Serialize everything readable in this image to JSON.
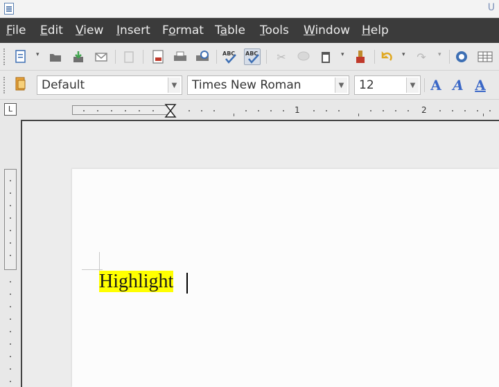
{
  "titlebar": {
    "title_fragment": "U"
  },
  "menu": {
    "items": [
      {
        "pre": "",
        "u": "F",
        "post": "ile"
      },
      {
        "pre": "",
        "u": "E",
        "post": "dit"
      },
      {
        "pre": "",
        "u": "V",
        "post": "iew"
      },
      {
        "pre": "",
        "u": "I",
        "post": "nsert"
      },
      {
        "pre": "F",
        "u": "o",
        "post": "rmat"
      },
      {
        "pre": "T",
        "u": "a",
        "post": "ble"
      },
      {
        "pre": "",
        "u": "T",
        "post": "ools"
      },
      {
        "pre": "",
        "u": "W",
        "post": "indow"
      },
      {
        "pre": "",
        "u": "H",
        "post": "elp"
      }
    ]
  },
  "toolbar": {
    "icons": [
      "new-document-icon",
      "open-folder-icon",
      "save-icon",
      "email-icon",
      "edit-file-icon",
      "export-pdf-icon",
      "print-icon",
      "print-preview-icon",
      "spellcheck-icon",
      "autospellcheck-icon",
      "cut-icon",
      "copy-icon",
      "paste-icon",
      "clone-formatting-icon",
      "undo-icon",
      "redo-icon",
      "navigator-icon",
      "table-icon"
    ],
    "pressed_icon": "autospellcheck-icon",
    "spell_label": "ABC"
  },
  "formatting": {
    "style_value": "Default",
    "font_value": "Times New Roman",
    "size_value": "12",
    "font_buttons": [
      "A",
      "A",
      "A"
    ]
  },
  "ruler": {
    "numbers": [
      "1",
      "2"
    ],
    "corner_glyph": "L"
  },
  "document": {
    "highlighted_text": "Highlight",
    "highlight_color": "#ffff00"
  },
  "colors": {
    "menubar": "#3b3b3b",
    "accent": "#3a67c7"
  }
}
